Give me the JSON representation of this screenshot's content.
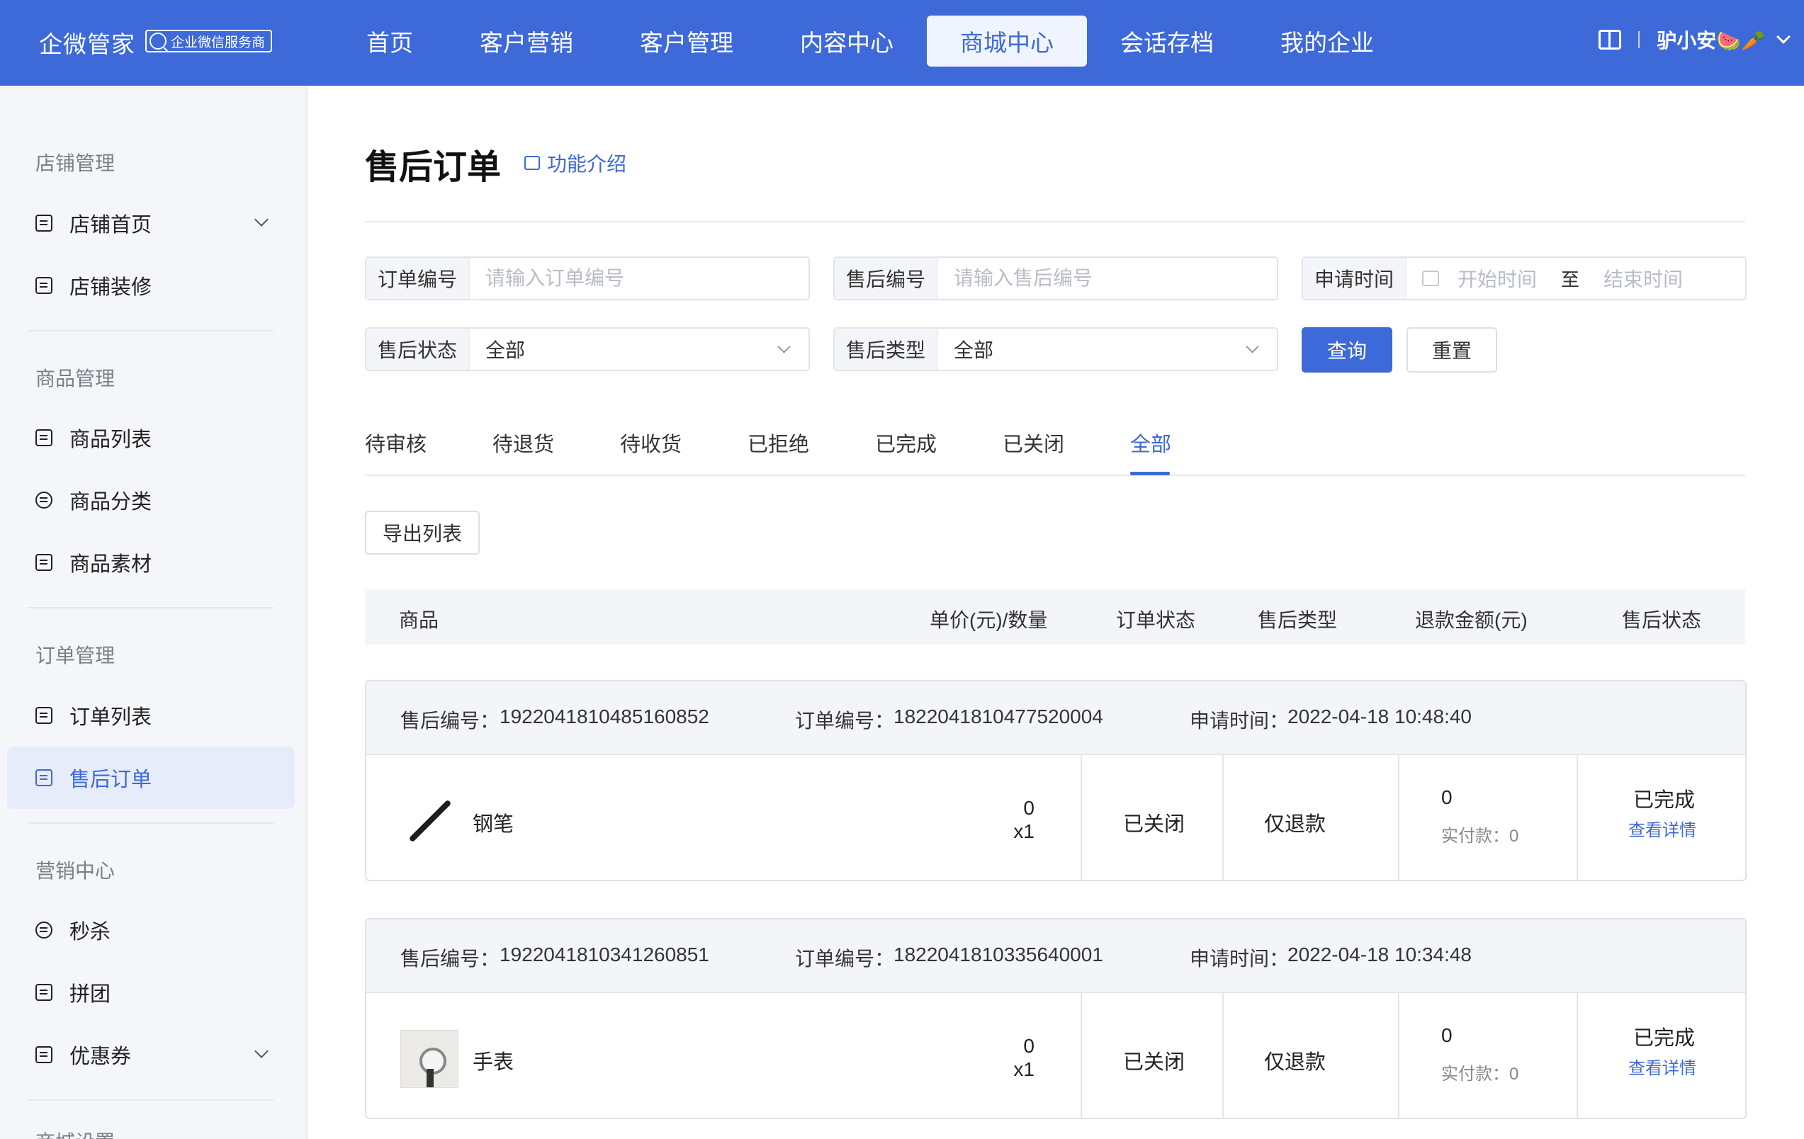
{
  "topbar": {
    "brand": "企微管家",
    "badge": "企业微信服务商",
    "nav": [
      "首页",
      "客户营销",
      "客户管理",
      "内容中心",
      "商城中心",
      "会话存档",
      "我的企业"
    ],
    "active_nav": "商城中心",
    "user_name": "驴小安🍉🥕",
    "accent_color": "#3d69d9"
  },
  "sidebar": {
    "groups": [
      {
        "title": "店铺管理",
        "items": [
          {
            "label": "店铺首页",
            "icon": "store-icon",
            "expandable": true
          },
          {
            "label": "店铺装修",
            "icon": "decorate-icon"
          }
        ]
      },
      {
        "title": "商品管理",
        "items": [
          {
            "label": "商品列表",
            "icon": "list-icon"
          },
          {
            "label": "商品分类",
            "icon": "category-icon"
          },
          {
            "label": "商品素材",
            "icon": "material-icon"
          }
        ]
      },
      {
        "title": "订单管理",
        "items": [
          {
            "label": "订单列表",
            "icon": "clipboard-icon"
          },
          {
            "label": "售后订单",
            "icon": "aftersale-icon",
            "active": true
          }
        ]
      },
      {
        "title": "营销中心",
        "items": [
          {
            "label": "秒杀",
            "icon": "flash-icon"
          },
          {
            "label": "拼团",
            "icon": "group-buy-icon"
          },
          {
            "label": "优惠券",
            "icon": "coupon-icon",
            "expandable": true
          }
        ]
      },
      {
        "title": "商城设置",
        "items": []
      }
    ]
  },
  "page": {
    "title": "售后订单",
    "intro_link": "功能介绍"
  },
  "filters": {
    "order_no_label": "订单编号",
    "order_no_placeholder": "请输入订单编号",
    "aftersale_no_label": "售后编号",
    "aftersale_no_placeholder": "请输入售后编号",
    "apply_time_label": "申请时间",
    "start_placeholder": "开始时间",
    "range_sep": "至",
    "end_placeholder": "结束时间",
    "status_label": "售后状态",
    "status_value": "全部",
    "type_label": "售后类型",
    "type_value": "全部",
    "query_button": "查询",
    "reset_button": "重置"
  },
  "tabs": [
    "待审核",
    "待退货",
    "待收货",
    "已拒绝",
    "已完成",
    "已关闭",
    "全部"
  ],
  "active_tab": "全部",
  "export_button": "导出列表",
  "table": {
    "headers": [
      "商品",
      "单价(元)/数量",
      "订单状态",
      "售后类型",
      "退款金额(元)",
      "售后状态"
    ]
  },
  "orders": [
    {
      "aftersale_no_label": "售后编号：",
      "aftersale_no": "1922041810485160852",
      "order_no_label": "订单编号：",
      "order_no": "1822041810477520004",
      "apply_time_label": "申请时间：",
      "apply_time": "2022-04-18 10:48:40",
      "product": "钢笔",
      "image": "pen-image",
      "price": "0",
      "qty": "x1",
      "order_status": "已关闭",
      "aftersale_type": "仅退款",
      "refund": "0",
      "paid": "实付款：0",
      "status": "已完成",
      "detail_link": "查看详情"
    },
    {
      "aftersale_no_label": "售后编号：",
      "aftersale_no": "1922041810341260851",
      "order_no_label": "订单编号：",
      "order_no": "1822041810335640001",
      "apply_time_label": "申请时间：",
      "apply_time": "2022-04-18 10:34:48",
      "product": "手表",
      "image": "watch-image",
      "price": "0",
      "qty": "x1",
      "order_status": "已关闭",
      "aftersale_type": "仅退款",
      "refund": "0",
      "paid": "实付款：0",
      "status": "已完成",
      "detail_link": "查看详情"
    }
  ]
}
